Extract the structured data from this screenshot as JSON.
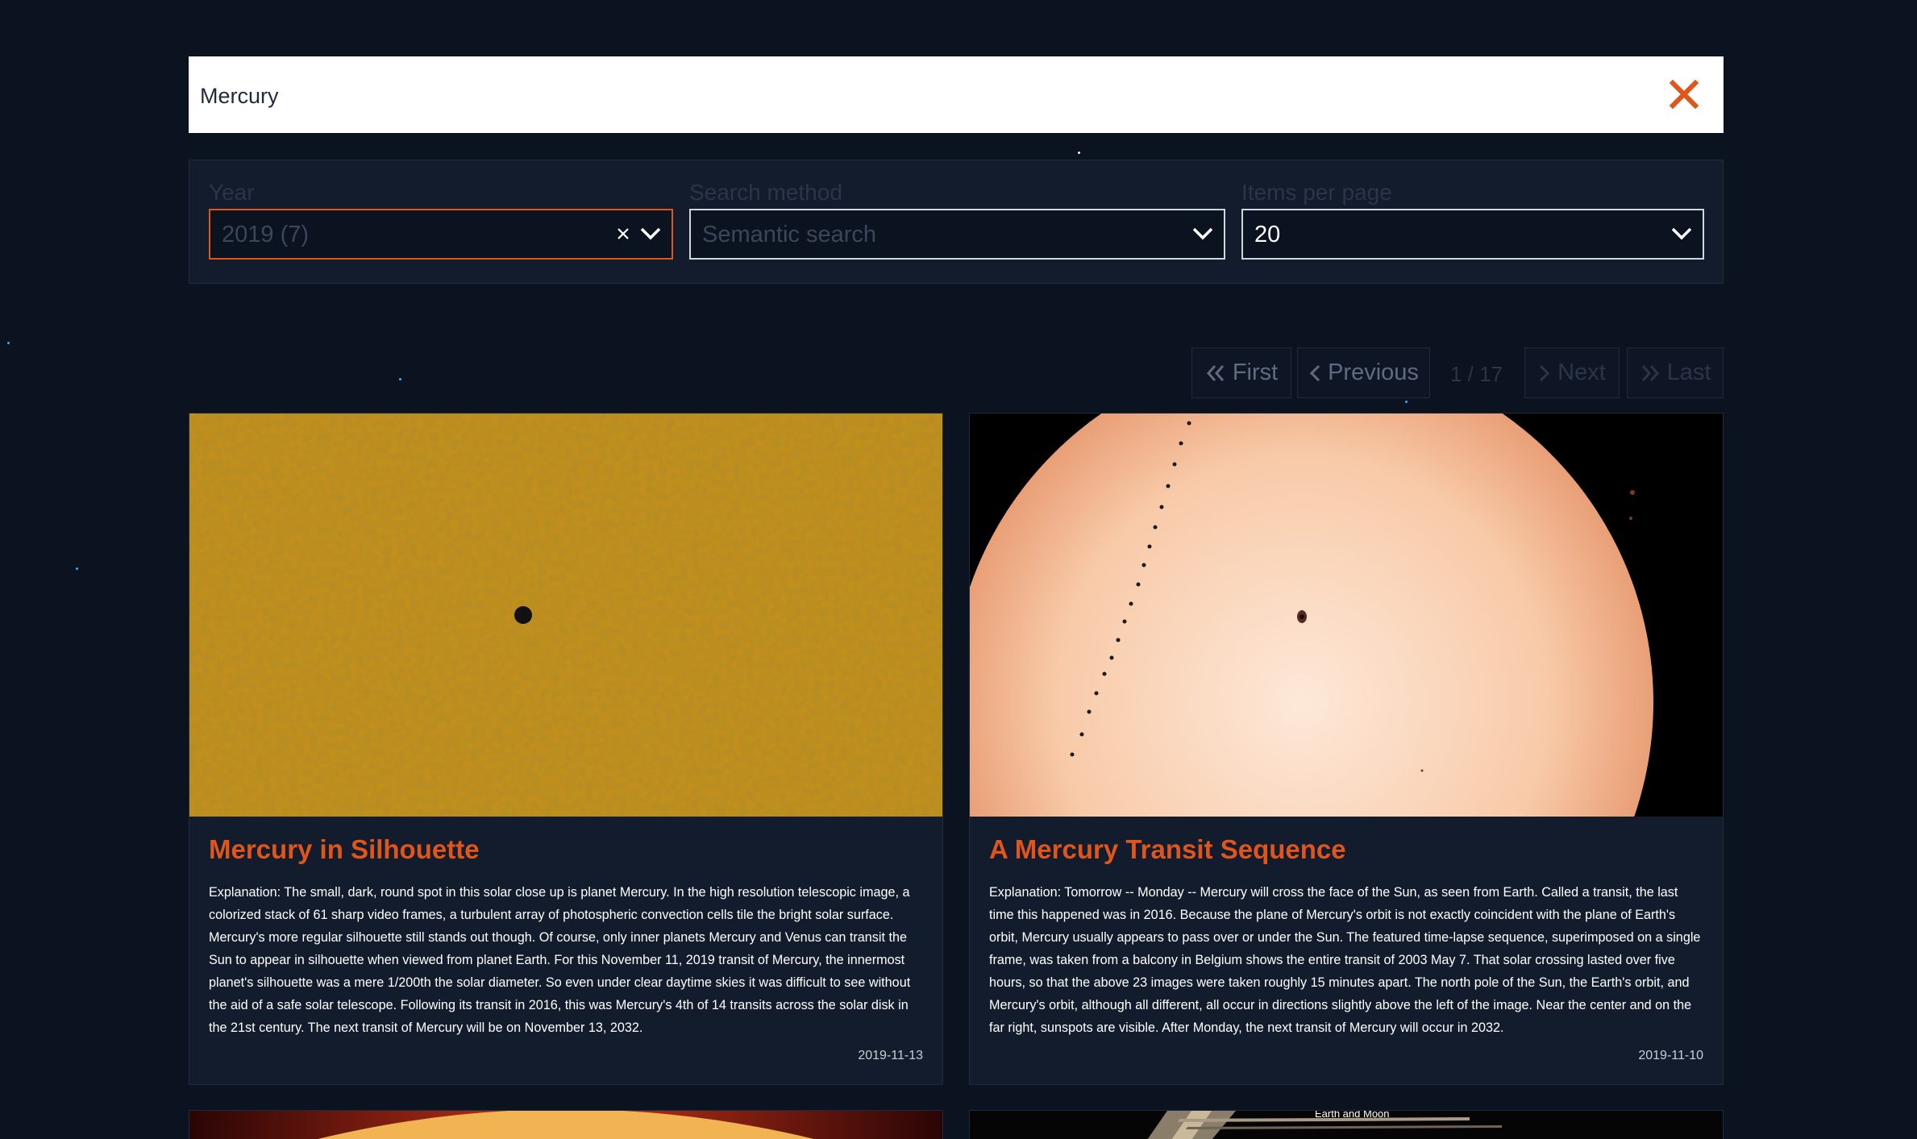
{
  "search": {
    "value": "Mercury"
  },
  "filters": {
    "year": {
      "label": "Year",
      "value": "2019 (7)"
    },
    "method": {
      "label": "Search method",
      "value": "Semantic search"
    },
    "per_page": {
      "label": "Items per page",
      "value": "20"
    }
  },
  "pagination": {
    "first": "First",
    "previous": "Previous",
    "info": "1 / 17",
    "next": "Next",
    "last": "Last"
  },
  "cards": [
    {
      "title": "Mercury in Silhouette",
      "explanation": "Explanation: The small, dark, round spot in this solar close up is planet Mercury. In the high resolution telescopic image, a colorized stack of 61 sharp video frames, a turbulent array of photospheric convection cells tile the bright solar surface. Mercury's more regular silhouette still stands out though. Of course, only inner planets Mercury and Venus can transit the Sun to appear in silhouette when viewed from planet Earth. For this November 11, 2019 transit of Mercury, the innermost planet's silhouette was a mere 1/200th the solar diameter. So even under clear daytime skies it was difficult to see without the aid of a safe solar telescope. Following its transit in 2016, this was Mercury's 4th of 14 transits across the solar disk in the 21st century. The next transit of Mercury will be on November 13, 2032.",
      "date": "2019-11-13"
    },
    {
      "title": "A Mercury Transit Sequence",
      "explanation": "Explanation: Tomorrow -- Monday -- Mercury will cross the face of the Sun, as seen from Earth. Called a transit, the last time this happened was in 2016. Because the plane of Mercury's orbit is not exactly coincident with the plane of Earth's orbit, Mercury usually appears to pass over or under the Sun. The featured time-lapse sequence, superimposed on a single frame, was taken from a balcony in Belgium shows the entire transit of 2003 May 7. That solar crossing lasted over five hours, so that the above 23 images were taken roughly 15 minutes apart. The north pole of the Sun, the Earth's orbit, and Mercury's orbit, although all different, all occur in directions slightly above the left of the image. Near the center and on the far right, sunspots are visible. After Monday, the next transit of Mercury will occur in 2032.",
      "date": "2019-11-10"
    },
    {
      "image_caption": "Earth and Moon"
    }
  ],
  "colors": {
    "accent": "#e0551a",
    "background": "#0b1220",
    "panel": "#131c2d"
  },
  "icons": [
    "close-icon",
    "clear-icon",
    "chevron-down-icon",
    "double-chevron-left-icon",
    "chevron-left-icon",
    "chevron-right-icon",
    "double-chevron-right-icon"
  ]
}
